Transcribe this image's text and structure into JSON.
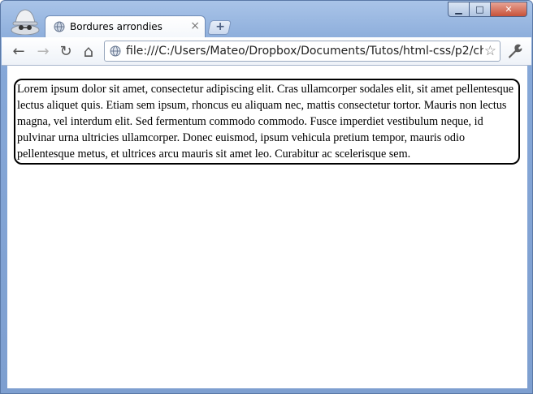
{
  "browser": {
    "tab": {
      "title": "Bordures arrondies",
      "close_glyph": "×"
    },
    "new_tab_glyph": "+",
    "window_controls": {
      "minimize": "▁",
      "maximize": "□",
      "close": "✕"
    },
    "toolbar": {
      "back_glyph": "←",
      "forward_glyph": "→",
      "reload_glyph": "↻",
      "home_glyph": "⌂",
      "url": "file:///C:/Users/Mateo/Dropbox/Documents/Tutos/html-css/p2/ch",
      "star_glyph": "☆"
    },
    "icons": [
      "incognito-icon",
      "globe-icon",
      "star-icon",
      "wrench-icon"
    ]
  },
  "page": {
    "paragraph": "Lorem ipsum dolor sit amet, consectetur adipiscing elit. Cras ullamcorper sodales elit, sit amet pellentesque lectus aliquet quis. Etiam sem ipsum, rhoncus eu aliquam nec, mattis consectetur tortor. Mauris non lectus magna, vel interdum elit. Sed fermentum commodo commodo. Fusce imperdiet vestibulum neque, id pulvinar urna ultricies ullamcorper. Donec euismod, ipsum vehicula pretium tempor, mauris odio pellentesque metus, et ultrices arcu mauris sit amet leo. Curabitur ac scelerisque sem."
  }
}
